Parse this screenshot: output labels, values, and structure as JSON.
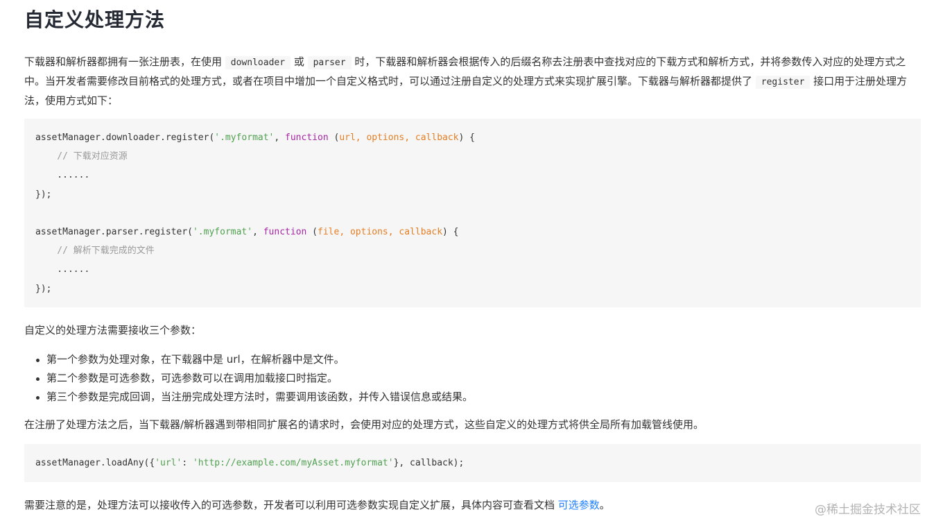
{
  "heading": "自定义处理方法",
  "intro": {
    "t1": "下载器和解析器都拥有一张注册表，在使用 ",
    "code1": "downloader",
    "t2": " 或 ",
    "code2": "parser",
    "t3": " 时，下载器和解析器会根据传入的后缀名称去注册表中查找对应的下载方式和解析方式，并将参数传入对应的处理方式之中。当开发者需要修改目前格式的处理方式，或者在项目中增加一个自定义格式时，可以通过注册自定义的处理方式来实现扩展引擎。下载器与解析器都提供了 ",
    "code3": "register",
    "t4": " 接口用于注册处理方法，使用方式如下："
  },
  "code_block_1": {
    "l1a": "assetManager.downloader.register(",
    "l1str": "'.myformat'",
    "l1b": ", ",
    "l1kw": "function",
    "l1c": " (",
    "l1params": "url, options, callback",
    "l1d": ") {",
    "l2": "    // 下载对应资源",
    "l3": "    ......",
    "l4": "});",
    "l6a": "assetManager.parser.register(",
    "l6str": "'.myformat'",
    "l6b": ", ",
    "l6kw": "function",
    "l6c": " (",
    "l6params": "file, options, callback",
    "l6d": ") {",
    "l7": "    // 解析下载完成的文件",
    "l8": "    ......",
    "l9": "});"
  },
  "params_intro": "自定义的处理方法需要接收三个参数：",
  "params_list": [
    "第一个参数为处理对象，在下载器中是 url，在解析器中是文件。",
    "第二个参数是可选参数，可选参数可以在调用加载接口时指定。",
    "第三个参数是完成回调，当注册完成处理方法时，需要调用该函数，并传入错误信息或结果。"
  ],
  "after_register": "在注册了处理方法之后，当下载器/解析器遇到带相同扩展名的请求时，会使用对应的处理方式，这些自定义的处理方式将供全局所有加载管线使用。",
  "code_block_2": {
    "a": "assetManager.loadAny({",
    "key": "'url'",
    "b": ": ",
    "val": "'http://example.com/myAsset.myformat'",
    "c": "}, callback);"
  },
  "note": {
    "text": "需要注意的是，处理方法可以接收传入的可选参数，开发者可以利用可选参数实现自定义扩展，具体内容可查看文档 ",
    "link": "可选参数",
    "end": "。"
  },
  "watermark": "@稀土掘金技术社区",
  "colors": {
    "link": "#1e80ff",
    "code_bg": "#f6f6f7",
    "string": "#50a14f",
    "keyword": "#a626a4",
    "param": "#e67e22",
    "comment": "#999999"
  }
}
